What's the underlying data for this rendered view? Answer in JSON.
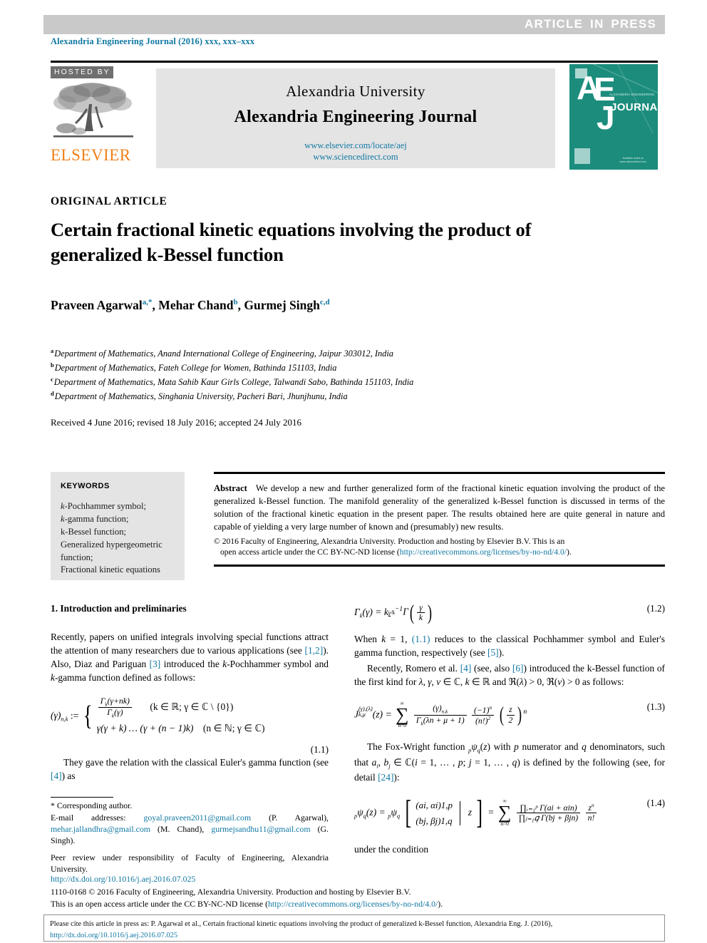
{
  "banner": {
    "press_label": "ARTICLE  IN  PRESS",
    "journal_ref": "Alexandria Engineering Journal (2016) xxx, xxx–xxx",
    "banner_color": "#c9c9c9"
  },
  "masthead": {
    "hosted_by": "HOSTED BY",
    "publisher": "ELSEVIER",
    "publisher_color": "#ef8019",
    "university": "Alexandria University",
    "journal_name": "Alexandria Engineering Journal",
    "link1": "www.elsevier.com/locate/aej",
    "link2": "www.sciencedirect.com",
    "cover": {
      "letter_a": "A",
      "letter_e": "E",
      "letter_j": "J",
      "journal_word": "JOURNAL",
      "small_top": "ALEXANDRIA ENGINEERING",
      "bottom_text": "Available online at www.sciencedirect.com",
      "bg_color": "#1c8d7d"
    }
  },
  "article": {
    "type_label": "ORIGINAL ARTICLE",
    "title": "Certain fractional kinetic equations involving the product of generalized k-Bessel function",
    "authors": [
      {
        "name": "Praveen Agarwal",
        "marks": "a,*"
      },
      {
        "name": "Mehar Chand",
        "marks": "b"
      },
      {
        "name": "Gurmej Singh",
        "marks": "c,d"
      }
    ],
    "affiliations": [
      {
        "mark": "a",
        "text": "Department of Mathematics, Anand International College of Engineering, Jaipur 303012, India"
      },
      {
        "mark": "b",
        "text": "Department of Mathematics, Fateh College for Women, Bathinda 151103, India"
      },
      {
        "mark": "c",
        "text": "Department of Mathematics, Mata Sahib Kaur Girls College, Talwandi Sabo, Bathinda 151103, India"
      },
      {
        "mark": "d",
        "text": "Department of Mathematics, Singhania University, Pacheri Bari, Jhunjhunu, India"
      }
    ],
    "history": "Received 4 June 2016; revised 18 July 2016; accepted 24 July 2016"
  },
  "keywords": {
    "heading": "KEYWORDS",
    "items": [
      "k-Pochhammer symbol;",
      "k-gamma function;",
      "k-Bessel function;",
      "Generalized hypergeometric function;",
      "Fractional kinetic equations"
    ]
  },
  "abstract": {
    "label": "Abstract",
    "text": "We develop a new and further generalized form of the fractional kinetic equation involving the product of the generalized k-Bessel function. The manifold generality of the generalized k-Bessel function is discussed in terms of the solution of the fractional kinetic equation in the present paper. The results obtained here are quite general in nature and capable of yielding a very large number of known and (presumably) new results.",
    "copyright_line1": "© 2016 Faculty of Engineering, Alexandria University. Production and hosting by Elsevier B.V. This is an",
    "copyright_line2_pre": "open access article under the CC BY-NC-ND license (",
    "copyright_link": "http://creativecommons.org/licenses/by-no-nd/4.0/",
    "copyright_line2_post": ")."
  },
  "left_column": {
    "section_heading": "1. Introduction and preliminaries",
    "para1_a": "Recently, papers on unified integrals involving special functions attract the attention of many researchers due to various applications (see ",
    "para1_cite1": "[1,2]",
    "para1_b": "). Also, Diaz and Pariguan ",
    "para1_cite2": "[3]",
    "para1_c": " introduced the k-Pochhammer symbol and k-gamma function defined as follows:",
    "eq11": {
      "lhs": "(γ)n,k :=",
      "case1_num": "Γk(γ + nk)",
      "case1_den": "Γk(γ)",
      "case1_cond": "(k ∈ ℝ; γ ∈ ℂ \\ {0})",
      "case2": "γ(γ + k) … (γ + (n − 1)k)",
      "case2_cond": "(n ∈ ℕ; γ ∈ ℂ)",
      "number": "(1.1)"
    },
    "para2_a": "They gave the relation with the classical Euler's gamma function (see ",
    "para2_cite": "[4]",
    "para2_b": ") as"
  },
  "right_column": {
    "eq12": {
      "lhs": "Γk(γ) = k",
      "exp_num": "γ",
      "exp_den": "k",
      "exp_tail": "−1",
      "gamma": "Γ",
      "arg_num": "γ",
      "arg_den": "k",
      "number": "(1.2)"
    },
    "para1_a": "When k = 1, ",
    "para1_cite1": "(1.1)",
    "para1_b": " reduces to the classical Pochhammer symbol and Euler's gamma function, respectively (see ",
    "para1_cite2": "[5]",
    "para1_c": ").",
    "para2_a": "Recently, Romero et al. ",
    "para2_cite1": "[4]",
    "para2_b": " (see, also ",
    "para2_cite2": "[6]",
    "para2_c": ") introduced the k-Bessel function of the first kind for λ, γ, ν ∈ ℂ, k ∈ ℝ and ℜ(λ) > 0, ℜ(ν) > 0 as follows:",
    "eq13": {
      "lhs_base": "J",
      "lhs_sup": "(γ),(λ)",
      "lhs_sub": "k,μ",
      "lhs_arg": "(z) =",
      "sum_upper": "∞",
      "sum_lower": "n=0",
      "f1_num": "(γ)n,k",
      "f1_den": "Γk(λn + μ + 1)",
      "f2_num": "(−1)n",
      "f2_den": "(n!)2",
      "f3_num": "z",
      "f3_den": "2",
      "f3_exp": "n",
      "number": "(1.3)"
    },
    "para3_a": "The Fox-Wright function pψq(z) with p numerator and q denominators, such that ai, bj ∈ ℂ(i = 1, … , p; j = 1, … , q) is defined by the following (see, for detail ",
    "para3_cite": "[24]",
    "para3_b": "):",
    "eq14": {
      "lhs": "pψq(z) = pψq",
      "top": "(ai, αi)1,p",
      "bottom": "(bj, βj)1,q",
      "arg": "z",
      "sum_upper": "∞",
      "sum_lower": "n=0",
      "prod_num": "∏ᵢ₌₁ᵖ Γ(ai + αin)",
      "prod_den": "∏ⱼ₌₁𝑞 Γ(bj + βjn)",
      "tail_num": "zn",
      "tail_den": "n!",
      "number": "(1.4)"
    },
    "para4": "under the condition"
  },
  "footnotes": {
    "corresponding": "Corresponding author.",
    "email_label": "E-mail addresses:",
    "emails": [
      {
        "addr": "goyal.praveen2011@gmail.com",
        "who": "(P. Agarwal),"
      },
      {
        "addr": "mehar.jallandhra@gmail.com",
        "who": "(M. Chand),"
      },
      {
        "addr": "gurmejsandhu11@gmail.com",
        "who": "(G. Singh)."
      }
    ],
    "peer_review": "Peer review under responsibility of Faculty of Engineering, Alexandria University.",
    "doi": "http://dx.doi.org/10.1016/j.aej.2016.07.025",
    "issn_line1": "1110-0168 © 2016 Faculty of Engineering, Alexandria University. Production and hosting by Elsevier B.V.",
    "issn_line2_pre": "This is an open access article under the CC BY-NC-ND license (",
    "issn_link": "http://creativecommons.org/licenses/by-no-nd/4.0/",
    "issn_line2_post": ")."
  },
  "cite_box": {
    "text_pre": "Please cite this article in press as: P. Agarwal et al., Certain fractional kinetic equations involving the product of generalized k-Bessel function,  Alexandria Eng. J. (2016), ",
    "link": "http://dx.doi.org/10.1016/j.aej.2016.07.025"
  },
  "colors": {
    "link_blue": "#1178a3",
    "box_gray": "#e4e4e4",
    "banner_gray": "#c9c9c9",
    "elsevier_orange": "#ef8019",
    "cover_teal": "#1c8d7d"
  }
}
